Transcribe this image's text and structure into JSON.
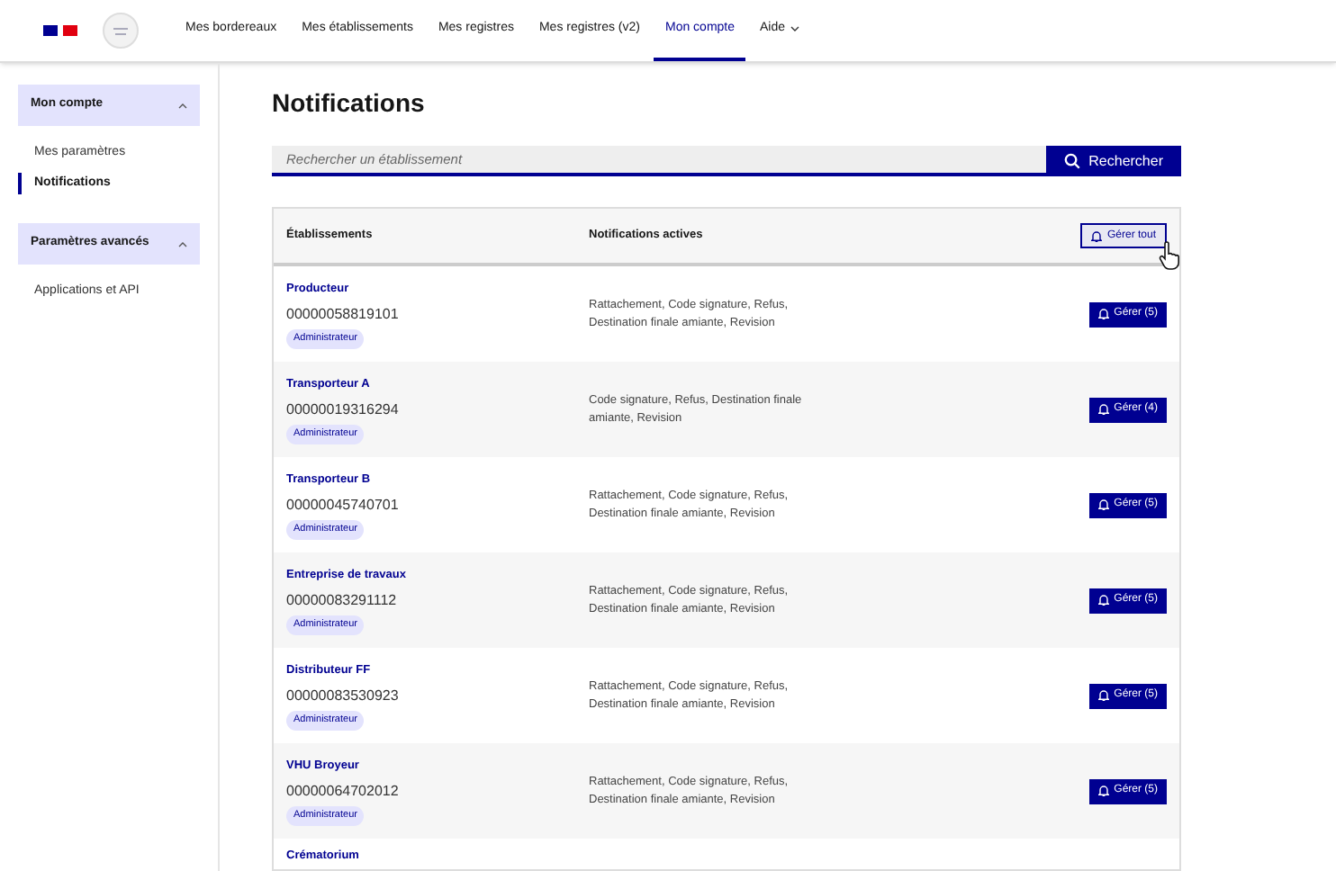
{
  "nav": [
    {
      "label": "Mes bordereaux",
      "selected": false,
      "dropdown": false
    },
    {
      "label": "Mes établissements",
      "selected": false,
      "dropdown": false
    },
    {
      "label": "Mes registres",
      "selected": false,
      "dropdown": false
    },
    {
      "label": "Mes registres (v2)",
      "selected": false,
      "dropdown": false
    },
    {
      "label": "Mon compte",
      "selected": true,
      "dropdown": false
    },
    {
      "label": "Aide",
      "selected": false,
      "dropdown": true
    }
  ],
  "sidebar": [
    {
      "label": "Mon compte",
      "expanded": true,
      "children": [
        {
          "label": "Mes paramètres",
          "selected": false
        },
        {
          "label": "Notifications",
          "selected": true
        }
      ]
    },
    {
      "label": "Paramètres avancés",
      "expanded": true,
      "children": [
        {
          "label": "Applications et API",
          "selected": false
        }
      ]
    }
  ],
  "page_title": "Notifications",
  "search": {
    "placeholder": "Rechercher un établissement",
    "button": "Rechercher"
  },
  "table": {
    "columns": [
      "Établissements",
      "Notifications actives"
    ],
    "manage_all": "Gérer tout",
    "rows": [
      {
        "name": "Producteur",
        "siret": "00000058819101",
        "role": "Administrateur",
        "notifications": "Rattachement, Code signature, Refus, Destination finale amiante, Revision",
        "action": "Gérer (5)"
      },
      {
        "name": "Transporteur A",
        "siret": "00000019316294",
        "role": "Administrateur",
        "notifications": "Code signature, Refus, Destination finale amiante, Revision",
        "action": "Gérer (4)"
      },
      {
        "name": "Transporteur B",
        "siret": "00000045740701",
        "role": "Administrateur",
        "notifications": "Rattachement, Code signature, Refus, Destination finale amiante, Revision",
        "action": "Gérer (5)"
      },
      {
        "name": "Entreprise de travaux",
        "siret": "00000083291112",
        "role": "Administrateur",
        "notifications": "Rattachement, Code signature, Refus, Destination finale amiante, Revision",
        "action": "Gérer (5)"
      },
      {
        "name": "Distributeur FF",
        "siret": "00000083530923",
        "role": "Administrateur",
        "notifications": "Rattachement, Code signature, Refus, Destination finale amiante, Revision",
        "action": "Gérer (5)"
      },
      {
        "name": "VHU Broyeur",
        "siret": "00000064702012",
        "role": "Administrateur",
        "notifications": "Rattachement, Code signature, Refus, Destination finale amiante, Revision",
        "action": "Gérer (5)"
      },
      {
        "name": "Crématorium"
      }
    ]
  }
}
